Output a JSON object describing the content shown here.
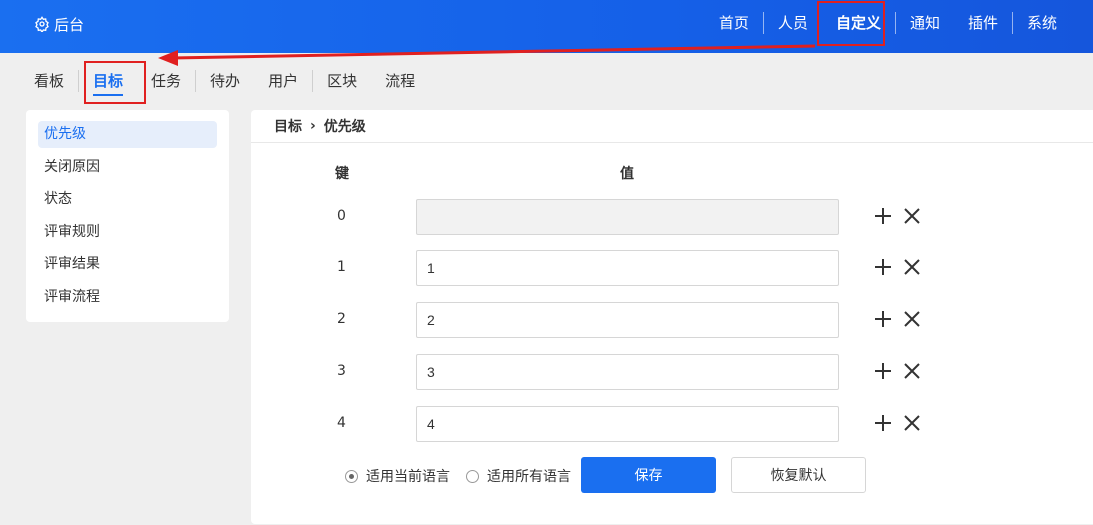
{
  "topbar": {
    "brand": "后台",
    "nav": [
      "首页",
      "人员",
      "自定义",
      "通知",
      "插件",
      "系统"
    ],
    "active_index": 2
  },
  "subnav": {
    "items": [
      "看板",
      "目标",
      "任务",
      "待办",
      "用户",
      "区块",
      "流程"
    ],
    "active_index": 1
  },
  "sidebar": {
    "items": [
      "优先级",
      "关闭原因",
      "状态",
      "评审规则",
      "评审结果",
      "评审流程"
    ],
    "active_index": 0
  },
  "breadcrumb": {
    "parent": "目标",
    "current": "优先级"
  },
  "table": {
    "key_header": "键",
    "value_header": "值",
    "rows": [
      {
        "key": "0",
        "value": ""
      },
      {
        "key": "1",
        "value": "1"
      },
      {
        "key": "2",
        "value": "2"
      },
      {
        "key": "3",
        "value": "3"
      },
      {
        "key": "4",
        "value": "4"
      }
    ]
  },
  "lang_options": {
    "current": "适用当前语言",
    "all": "适用所有语言",
    "selected": "current"
  },
  "actions": {
    "save": "保存",
    "reset": "恢复默认"
  },
  "colors": {
    "primary": "#1a6ff0",
    "annotation": "#e02020"
  }
}
